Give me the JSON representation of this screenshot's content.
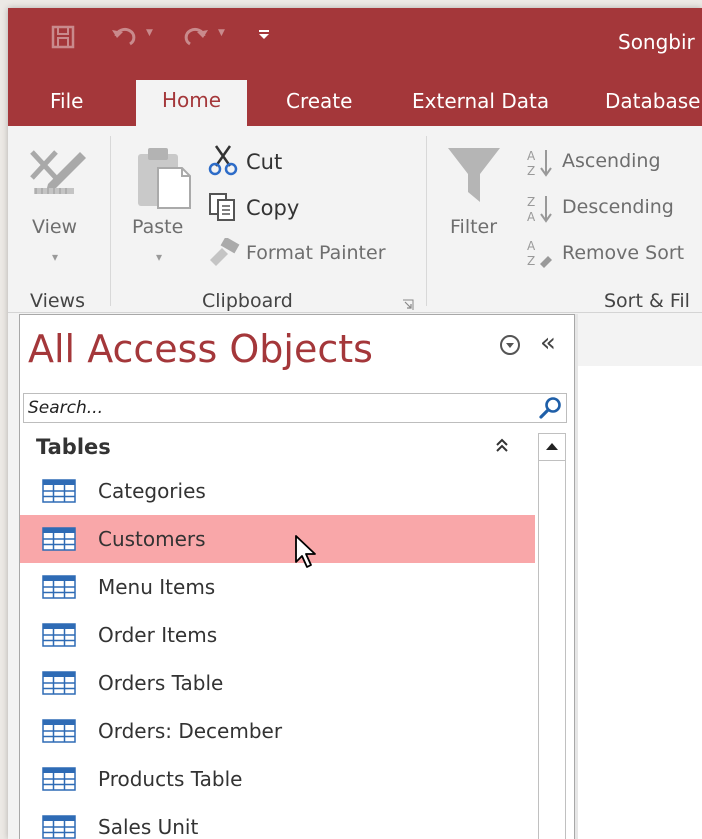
{
  "app": {
    "title": "Songbir"
  },
  "tabs": [
    {
      "label": "File"
    },
    {
      "label": "Home"
    },
    {
      "label": "Create"
    },
    {
      "label": "External Data"
    },
    {
      "label": "Database"
    }
  ],
  "ribbon": {
    "views": {
      "view_label": "View",
      "group_label": "Views"
    },
    "clipboard": {
      "paste_label": "Paste",
      "cut_label": "Cut",
      "copy_label": "Copy",
      "format_painter_label": "Format Painter",
      "group_label": "Clipboard"
    },
    "sort_filter": {
      "filter_label": "Filter",
      "ascending_label": "Ascending",
      "descending_label": "Descending",
      "remove_sort_label": "Remove Sort",
      "group_label": "Sort & Fil"
    }
  },
  "nav_pane": {
    "title": "All Access Objects",
    "search_placeholder": "Search...",
    "group_header": "Tables",
    "items": [
      {
        "label": "Categories"
      },
      {
        "label": "Customers"
      },
      {
        "label": "Menu Items"
      },
      {
        "label": "Order Items"
      },
      {
        "label": "Orders Table"
      },
      {
        "label": "Orders: December"
      },
      {
        "label": "Products Table"
      },
      {
        "label": "Sales Unit"
      }
    ],
    "selected_index": 1
  },
  "colors": {
    "accent": "#a4373a",
    "selection": "#f9a7a9"
  }
}
